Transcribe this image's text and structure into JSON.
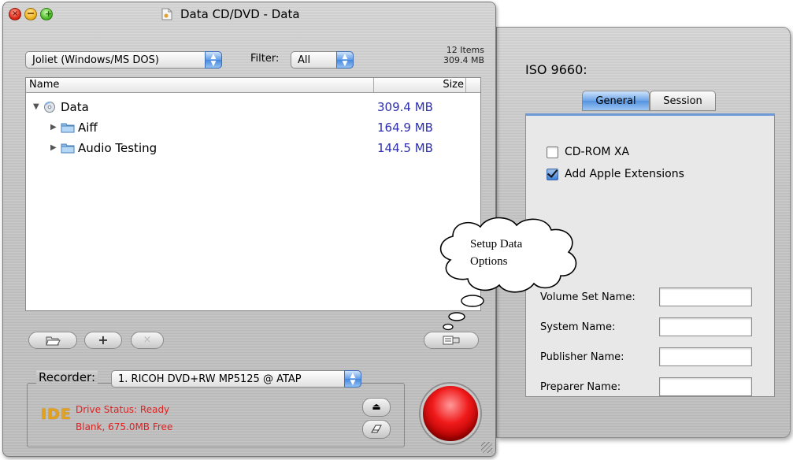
{
  "window": {
    "title": "Data CD/DVD - Data"
  },
  "toolbar": {
    "format_value": "Joliet (Windows/MS DOS)",
    "filter_label": "Filter:",
    "filter_value": "All",
    "items_count": "12 Items",
    "total_size": "309.4 MB"
  },
  "list": {
    "columns": {
      "name": "Name",
      "size": "Size"
    },
    "rows": [
      {
        "name": "Data",
        "size": "309.4 MB",
        "icon": "cd-icon",
        "expanded": true,
        "level": 0
      },
      {
        "name": "Aiff",
        "size": "164.9 MB",
        "icon": "folder-icon",
        "expanded": false,
        "level": 1
      },
      {
        "name": "Audio Testing",
        "size": "144.5 MB",
        "icon": "folder-icon",
        "expanded": false,
        "level": 1
      }
    ]
  },
  "bottom_buttons": {
    "add_symbol": "+",
    "remove_symbol": "×"
  },
  "recorder": {
    "label": "Recorder:",
    "device": "1. RICOH DVD+RW MP5125 @ ATAP",
    "badge": "IDE",
    "status": "Drive Status: Ready",
    "media": "Blank, 675.0MB Free"
  },
  "drawer": {
    "title": "ISO 9660:",
    "tabs": [
      "General",
      "Session"
    ],
    "active_tab": "General",
    "checkboxes": [
      {
        "label": "CD-ROM XA",
        "checked": false
      },
      {
        "label": "Add Apple Extensions",
        "checked": true
      }
    ],
    "fields": [
      {
        "label": "Volume Set Name:",
        "value": ""
      },
      {
        "label": "System Name:",
        "value": ""
      },
      {
        "label": "Publisher Name:",
        "value": ""
      },
      {
        "label": "Preparer Name:",
        "value": ""
      }
    ]
  },
  "callout": {
    "line1": "Setup Data",
    "line2": "Options"
  },
  "colors": {
    "size_text": "#2d2fb0",
    "status_text": "#dd2222",
    "badge": "#e6a11b",
    "tab_active": "#5f9ce8",
    "burn": "#f01a1a"
  }
}
